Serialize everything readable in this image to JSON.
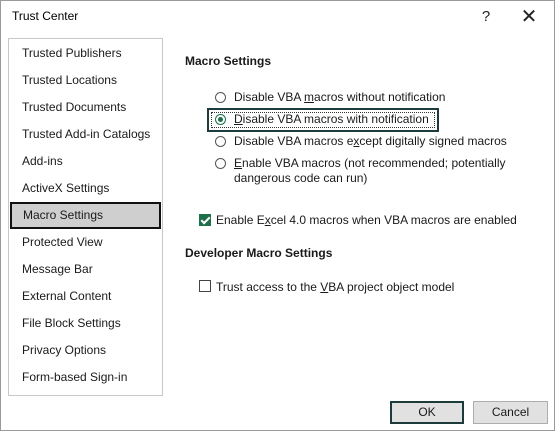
{
  "window": {
    "title": "Trust Center",
    "help_glyph": "?",
    "close_glyph": "✕"
  },
  "sidebar": {
    "items": [
      {
        "label": "Trusted Publishers",
        "selected": false
      },
      {
        "label": "Trusted Locations",
        "selected": false
      },
      {
        "label": "Trusted Documents",
        "selected": false
      },
      {
        "label": "Trusted Add-in Catalogs",
        "selected": false
      },
      {
        "label": "Add-ins",
        "selected": false
      },
      {
        "label": "ActiveX Settings",
        "selected": false
      },
      {
        "label": "Macro Settings",
        "selected": true
      },
      {
        "label": "Protected View",
        "selected": false
      },
      {
        "label": "Message Bar",
        "selected": false
      },
      {
        "label": "External Content",
        "selected": false
      },
      {
        "label": "File Block Settings",
        "selected": false
      },
      {
        "label": "Privacy Options",
        "selected": false
      },
      {
        "label": "Form-based Sign-in",
        "selected": false
      }
    ]
  },
  "macro_settings": {
    "title": "Macro Settings",
    "options": [
      {
        "pre": "Disable VBA ",
        "key": "m",
        "post": "acros without notification",
        "checked": false
      },
      {
        "pre": "",
        "key": "D",
        "post": "isable VBA macros with notification",
        "checked": true
      },
      {
        "pre": "Disable VBA macros e",
        "key": "x",
        "post": "cept digitally signed macros",
        "checked": false
      },
      {
        "pre": "",
        "key": "E",
        "post": "nable VBA macros (not recommended; potentially",
        "line2": "dangerous code can run)",
        "checked": false
      }
    ],
    "excel4": {
      "pre": "Enable E",
      "key": "x",
      "post": "cel 4.0 macros when VBA macros are enabled",
      "checked": true
    }
  },
  "developer": {
    "title": "Developer Macro Settings",
    "trust_vba": {
      "pre": "Trust access to the ",
      "key": "V",
      "post": "BA project object model",
      "checked": false
    }
  },
  "buttons": {
    "ok": "OK",
    "cancel": "Cancel"
  },
  "colors": {
    "accent": "#1e6f4a",
    "focus": "#1d3b3b",
    "selected_bg": "#cfcfcf"
  }
}
